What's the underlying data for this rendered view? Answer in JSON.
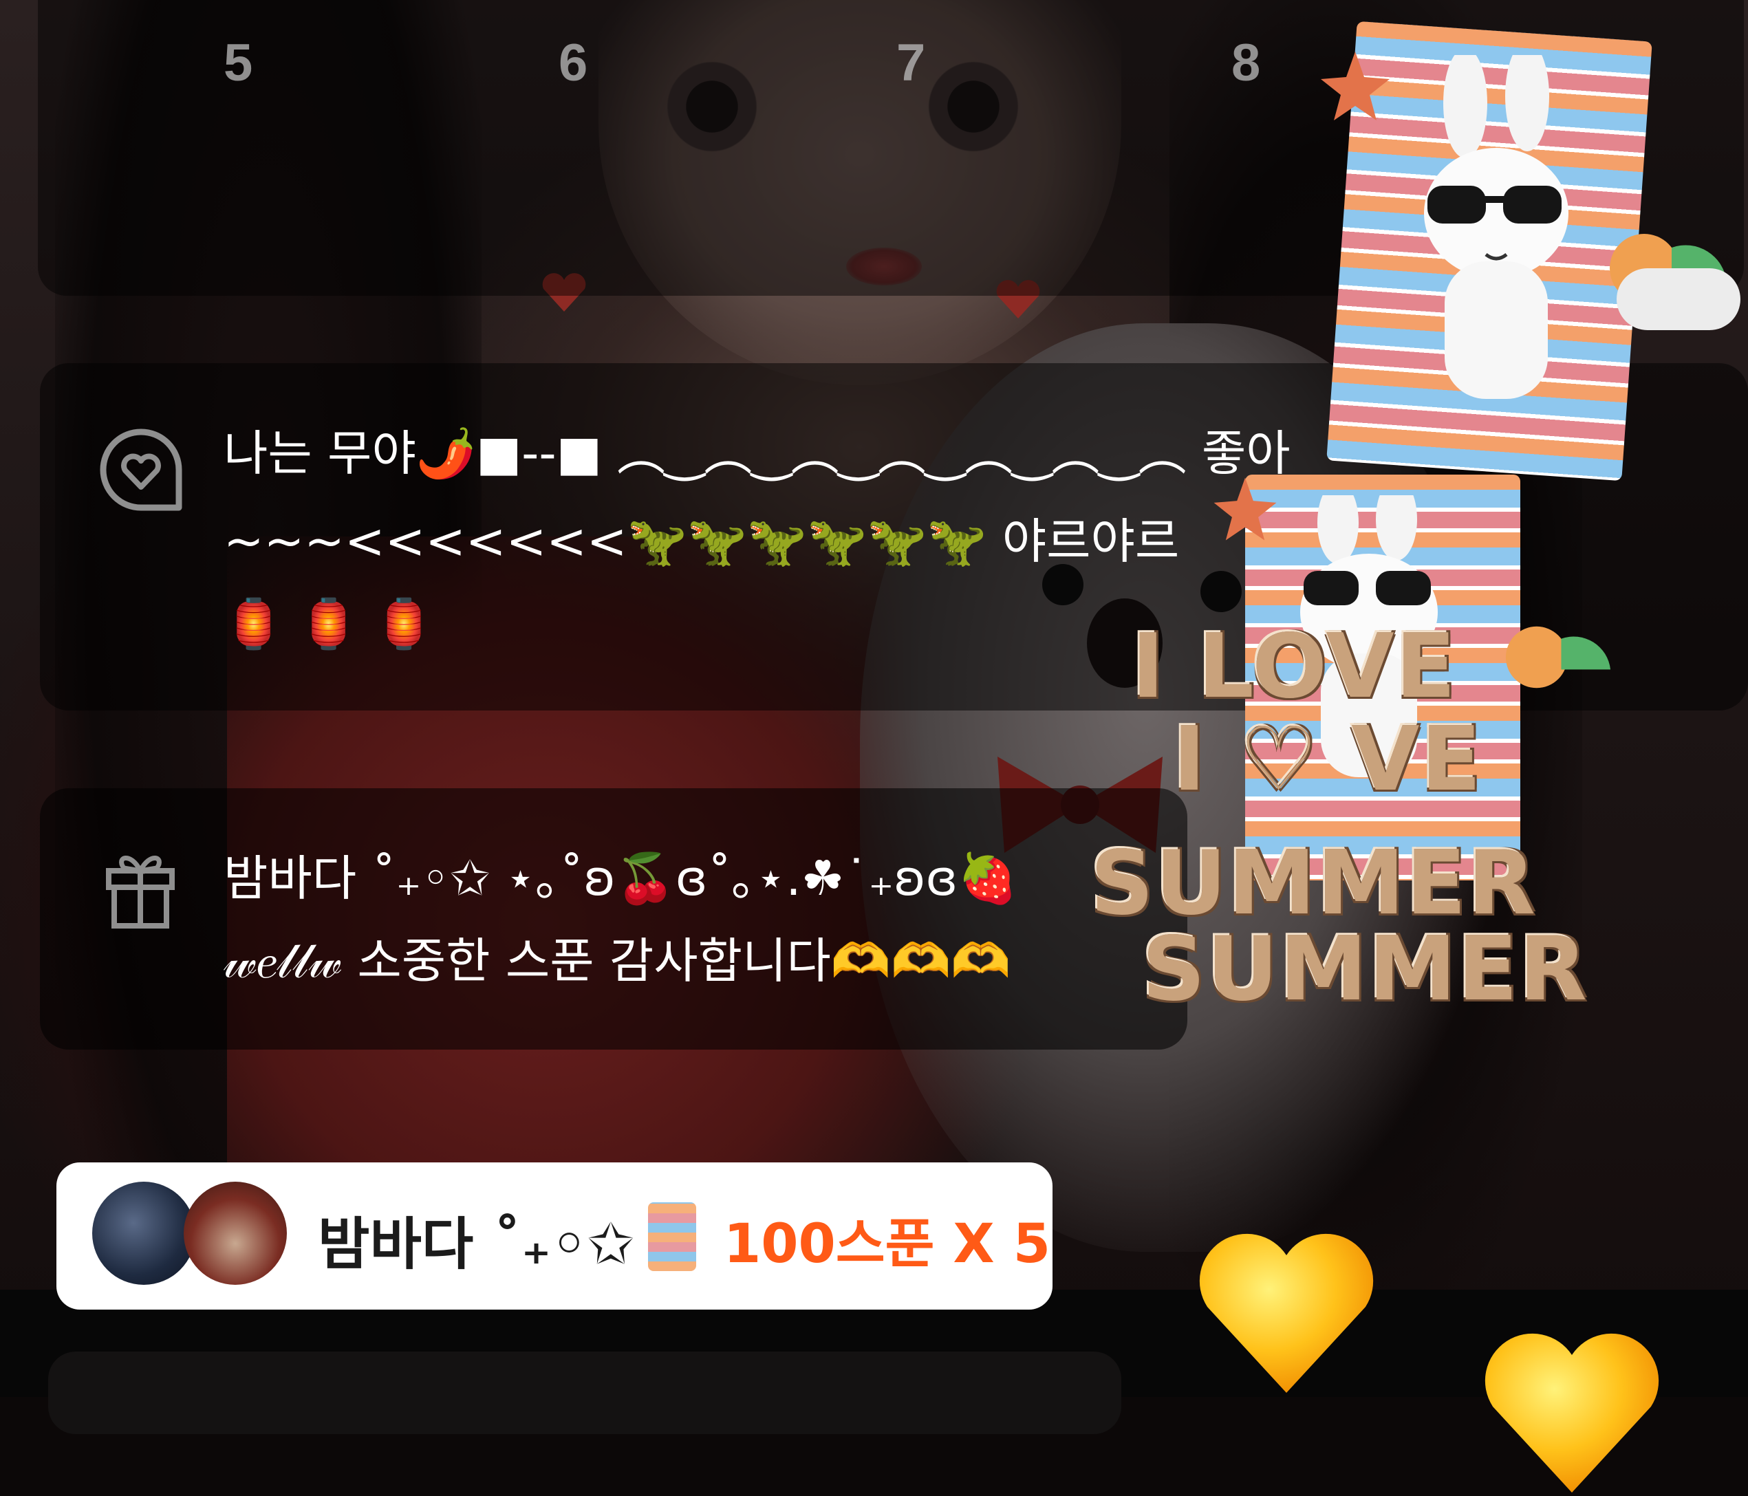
{
  "top_row": {
    "numbers": [
      "5",
      "6",
      "7",
      "8"
    ]
  },
  "messages": [
    {
      "icon": "speech-heart-icon",
      "lines": [
        "나는 무야🌶️■--■ ︵‿︵‿︵‿︵‿︵‿︵‿︵ 좋아",
        "~~~<<<<<<<🦖🦖🦖🦖🦖🦖 야르야르",
        "    🏮      🏮      🏮"
      ]
    },
    {
      "icon": "gift-icon",
      "lines": [
        "밤바다 ˚₊◦✩ ⋆｡˚ʚ🍒ɞ˚｡⋆.☘︎˙₊ʚɞ🍓",
        "𝓌𝑒𝓁𝓁𝓌 소중한 스푼 감사합니다🫶🫶🫶"
      ]
    }
  ],
  "gift_banner": {
    "sender_name": "밤바다 ˚₊◦✩",
    "amount": "100스푼 X 5"
  },
  "sticker": {
    "text_lines": [
      "I LOVE",
      "I ♡ VE",
      "SUMMER",
      "SUMMER"
    ]
  },
  "colors": {
    "accent": "#ff5a16",
    "banner_bg": "#ffffff"
  }
}
